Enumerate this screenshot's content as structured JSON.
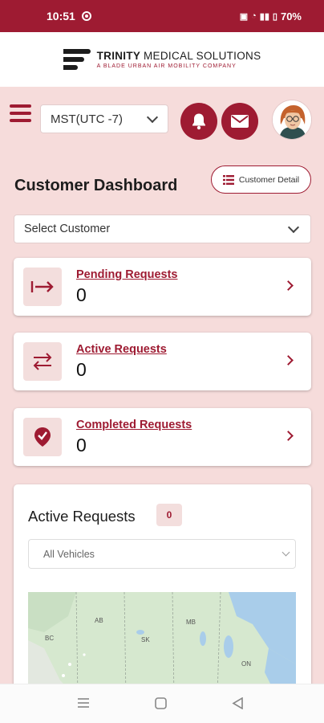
{
  "status_bar": {
    "time": "10:51",
    "battery": "70%"
  },
  "brand": {
    "name_bold": "TRINITY",
    "name_rest": "MEDICAL SOLUTIONS",
    "tagline": "A BLADE URBAN AIR MOBILITY COMPANY"
  },
  "toolbar": {
    "timezone": "MST(UTC -7)",
    "icons": [
      "menu-icon",
      "bell-icon",
      "mail-icon",
      "avatar"
    ]
  },
  "dashboard": {
    "title": "Customer Dashboard",
    "detail_button": "Customer Detail",
    "customer_select": "Select Customer"
  },
  "requests": {
    "pending": {
      "label": "Pending Requests",
      "count": "0"
    },
    "active": {
      "label": "Active Requests",
      "count": "0"
    },
    "completed": {
      "label": "Completed Requests",
      "count": "0"
    }
  },
  "active_panel": {
    "title": "Active Requests",
    "badge": "0",
    "vehicle_select": "All Vehicles",
    "map_labels": [
      "AB",
      "BC",
      "SK",
      "MB",
      "ON"
    ]
  },
  "colors": {
    "brand": "#9e1b32",
    "background": "#f6dcdb",
    "icon_tile": "#f3dedd"
  }
}
